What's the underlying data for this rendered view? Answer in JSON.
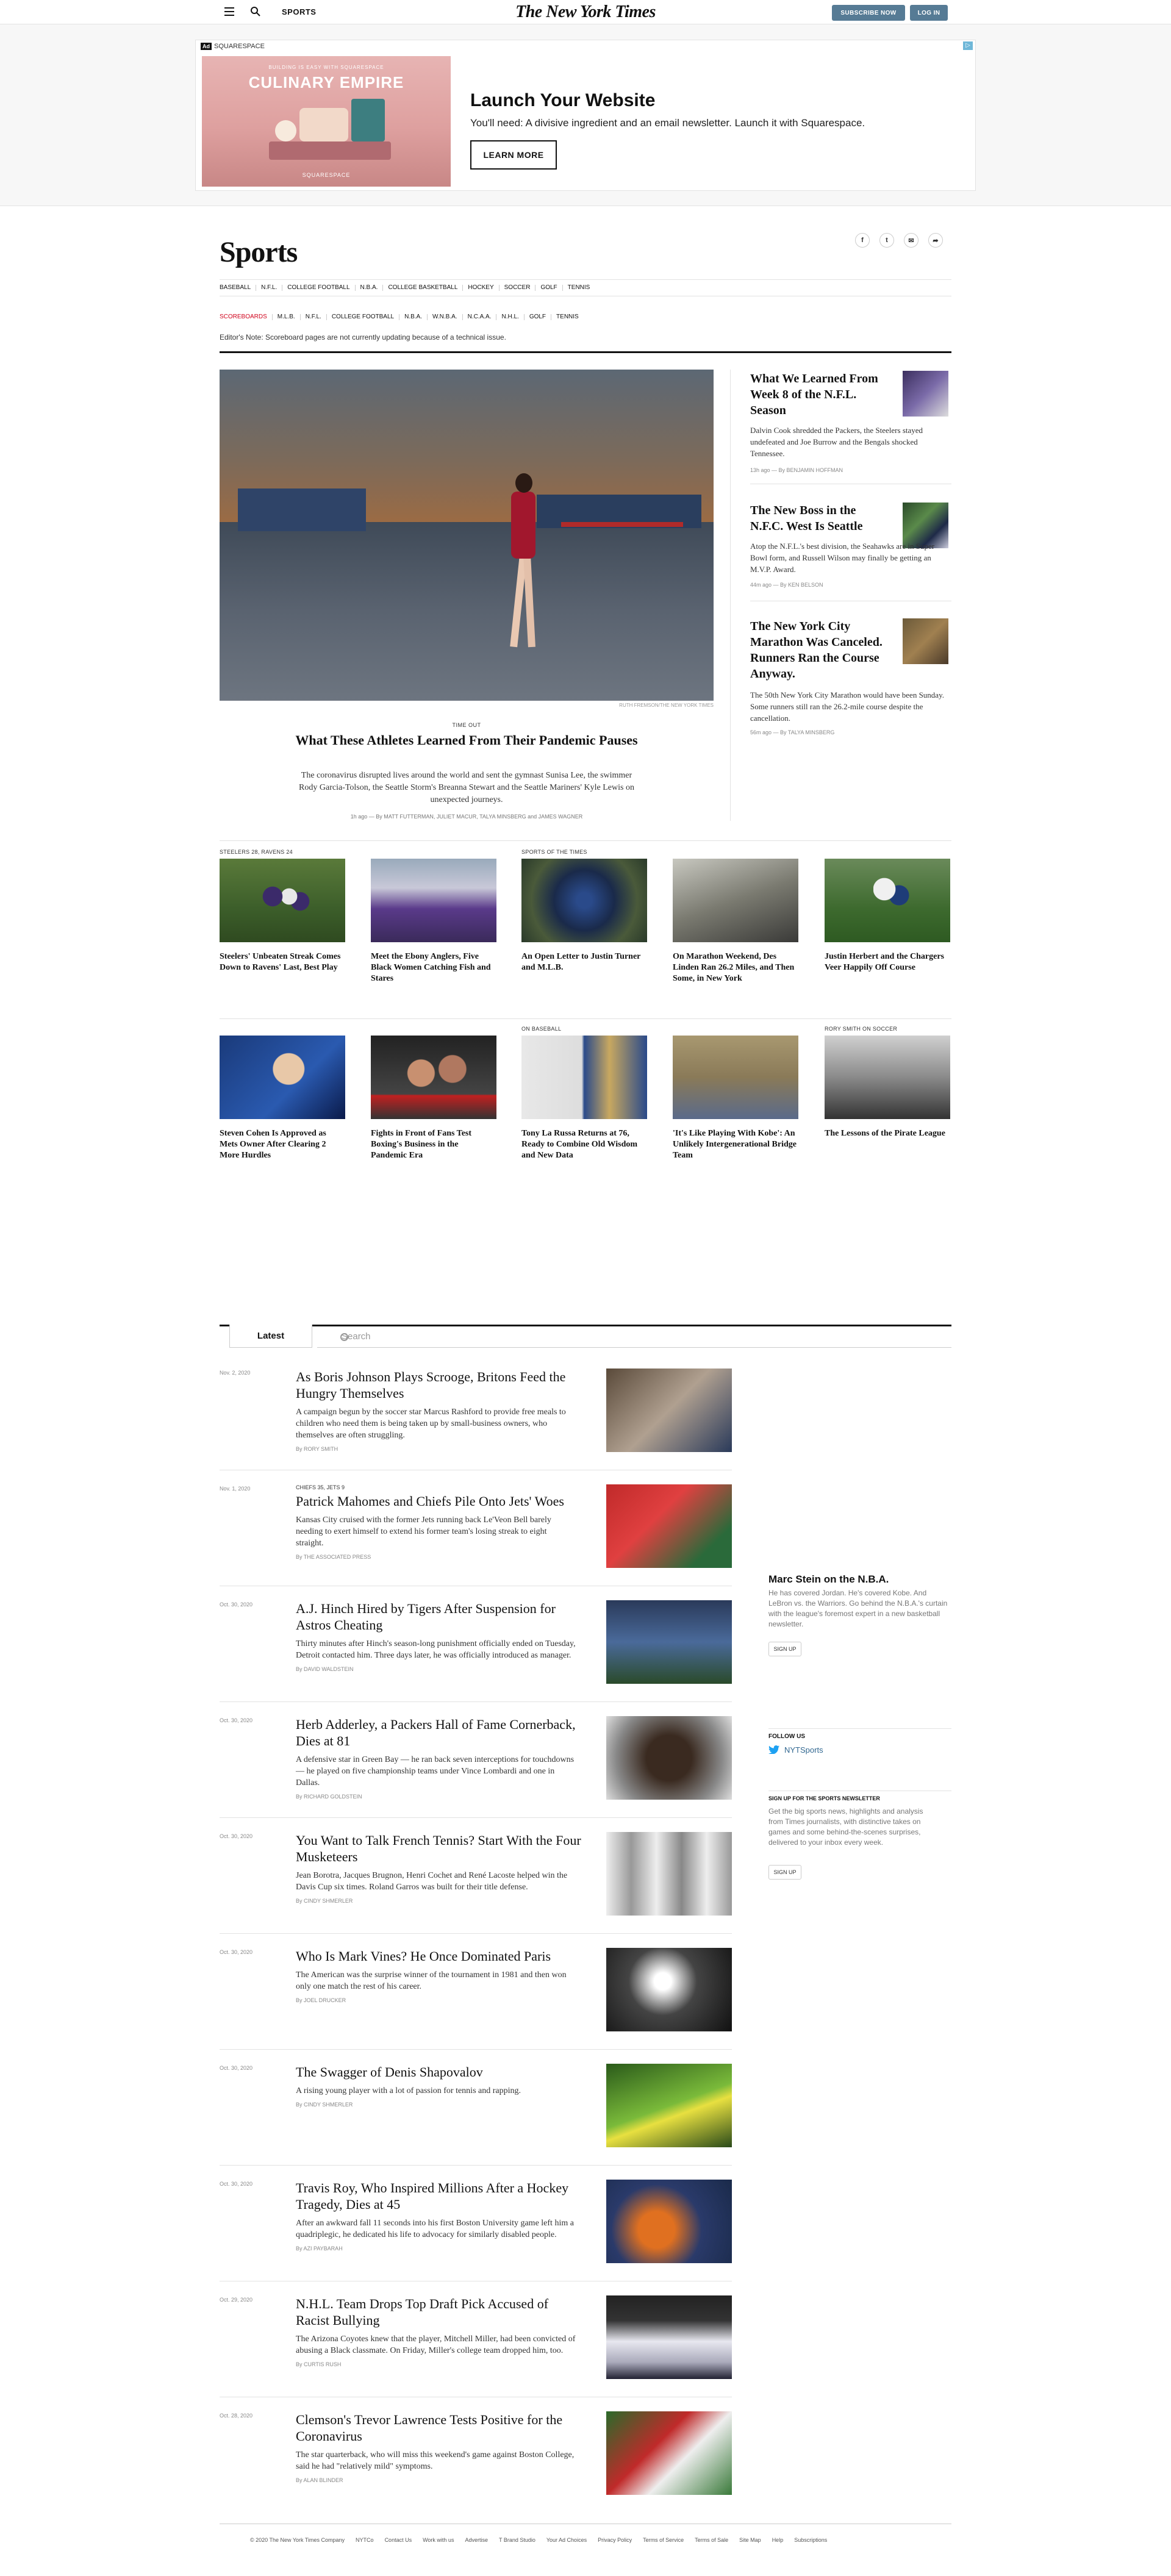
{
  "header": {
    "section": "SPORTS",
    "masthead": "The New York Times",
    "subscribe": "SUBSCRIBE NOW",
    "login": "LOG IN"
  },
  "ad": {
    "label": "SQUARESPACE",
    "badge": "Ad",
    "image_small": "BUILDING IS EASY WITH SQUARESPACE",
    "image_title": "CULINARY EMPIRE",
    "image_brand": "SQUARESPACE",
    "title": "Launch Your Website",
    "text": "You'll need: A divisive ingredient and an email newsletter. Launch it with Squarespace.",
    "button": "LEARN MORE"
  },
  "section": {
    "title": "Sports",
    "social": [
      "f",
      "t",
      "✉",
      "➦"
    ],
    "nav": [
      "BASEBALL",
      "N.F.L.",
      "COLLEGE FOOTBALL",
      "N.B.A.",
      "COLLEGE BASKETBALL",
      "HOCKEY",
      "SOCCER",
      "GOLF",
      "TENNIS"
    ],
    "subnav": [
      "SCOREBOARDS",
      "M.L.B.",
      "N.F.L.",
      "COLLEGE FOOTBALL",
      "N.B.A.",
      "W.N.B.A.",
      "N.C.A.A.",
      "N.H.L.",
      "GOLF",
      "TENNIS"
    ],
    "editor_note": "Editor's Note: Scoreboard pages are not currently updating because of a technical issue."
  },
  "lead": {
    "credit": "RUTH FREMSON/THE NEW YORK TIMES",
    "kicker": "TIME OUT",
    "headline": "What These Athletes Learned From Their Pandemic Pauses",
    "summary": "The coronavirus disrupted lives around the world and sent the gymnast Sunisa Lee, the swimmer Rody Garcia-Tolson, the Seattle Storm's Breanna Stewart and the Seattle Mariners' Kyle Lewis on unexpected journeys.",
    "byline": "1h ago — By MATT FUTTERMAN, JULIET MACUR, TALYA MINSBERG and JAMES WAGNER"
  },
  "right": [
    {
      "headline": "What We Learned From Week 8 of the N.F.L. Season",
      "summary": "Dalvin Cook shredded the Packers, the Steelers stayed undefeated and Joe Burrow and the Bengals shocked Tennessee.",
      "byline": "13h ago — By BENJAMIN HOFFMAN"
    },
    {
      "headline": "The New Boss in the N.F.C. West Is Seattle",
      "summary": "Atop the N.F.L.'s best division, the Seahawks are in Super Bowl form, and Russell Wilson may finally be getting an M.V.P. Award.",
      "byline": "44m ago — By KEN BELSON"
    },
    {
      "headline": "The New York City Marathon Was Canceled. Runners Ran the Course Anyway.",
      "summary": "The 50th New York City Marathon would have been Sunday. Some runners still ran the 26.2-mile course despite the cancellation.",
      "byline": "56m ago — By TALYA MINSBERG"
    }
  ],
  "row1": [
    {
      "kicker": "STEELERS 28, RAVENS 24",
      "headline": "Steelers' Unbeaten Streak Comes Down to Ravens' Last, Best Play"
    },
    {
      "kicker": "",
      "headline": "Meet the Ebony Anglers, Five Black Women Catching Fish and Stares"
    },
    {
      "kicker": "SPORTS OF THE TIMES",
      "headline": "An Open Letter to Justin Turner and M.L.B."
    },
    {
      "kicker": "",
      "headline": "On Marathon Weekend, Des Linden Ran 26.2 Miles, and Then Some, in New York"
    },
    {
      "kicker": "",
      "headline": "Justin Herbert and the Chargers Veer Happily Off Course"
    }
  ],
  "row2": [
    {
      "kicker": "",
      "headline": "Steven Cohen Is Approved as Mets Owner After Clearing 2 More Hurdles"
    },
    {
      "kicker": "",
      "headline": "Fights in Front of Fans Test Boxing's Business in the Pandemic Era"
    },
    {
      "kicker": "ON BASEBALL",
      "headline": "Tony La Russa Returns at 76, Ready to Combine Old Wisdom and New Data"
    },
    {
      "kicker": "",
      "headline": "'It's Like Playing With Kobe': An Unlikely Intergenerational Bridge Team"
    },
    {
      "kicker": "RORY SMITH ON SOCCER",
      "headline": "The Lessons of the Pirate League"
    }
  ],
  "latest": {
    "tab": "Latest",
    "search_placeholder": "Search",
    "items": [
      {
        "date": "Nov. 2, 2020",
        "kicker": "",
        "headline": "As Boris Johnson Plays Scrooge, Britons Feed the Hungry Themselves",
        "summary": "A campaign begun by the soccer star Marcus Rashford to provide free meals to children who need them is being taken up by small-business owners, who themselves are often struggling.",
        "byline": "By RORY SMITH"
      },
      {
        "date": "Nov. 1, 2020",
        "kicker": "CHIEFS 35, JETS 9",
        "headline": "Patrick Mahomes and Chiefs Pile Onto Jets' Woes",
        "summary": "Kansas City cruised with the former Jets running back Le'Veon Bell barely needing to exert himself to extend his former team's losing streak to eight straight.",
        "byline": "By THE ASSOCIATED PRESS"
      },
      {
        "date": "Oct. 30, 2020",
        "kicker": "",
        "headline": "A.J. Hinch Hired by Tigers After Suspension for Astros Cheating",
        "summary": "Thirty minutes after Hinch's season-long punishment officially ended on Tuesday, Detroit contacted him. Three days later, he was officially introduced as manager.",
        "byline": "By DAVID WALDSTEIN"
      },
      {
        "date": "Oct. 30, 2020",
        "kicker": "",
        "headline": "Herb Adderley, a Packers Hall of Fame Cornerback, Dies at 81",
        "summary": "A defensive star in Green Bay — he ran back seven interceptions for touchdowns — he played on five championship teams under Vince Lombardi and one in Dallas.",
        "byline": "By RICHARD GOLDSTEIN"
      },
      {
        "date": "Oct. 30, 2020",
        "kicker": "",
        "headline": "You Want to Talk French Tennis? Start With the Four Musketeers",
        "summary": "Jean Borotra, Jacques Brugnon, Henri Cochet and René Lacoste helped win the Davis Cup six times. Roland Garros was built for their title defense.",
        "byline": "By CINDY SHMERLER"
      },
      {
        "date": "Oct. 30, 2020",
        "kicker": "",
        "headline": "Who Is Mark Vines? He Once Dominated Paris",
        "summary": "The American was the surprise winner of the tournament in 1981 and then won only one match the rest of his career.",
        "byline": "By JOEL DRUCKER"
      },
      {
        "date": "Oct. 30, 2020",
        "kicker": "",
        "headline": "The Swagger of Denis Shapovalov",
        "summary": "A rising young player with a lot of passion for tennis and rapping.",
        "byline": "By CINDY SHMERLER"
      },
      {
        "date": "Oct. 30, 2020",
        "kicker": "",
        "headline": "Travis Roy, Who Inspired Millions After a Hockey Tragedy, Dies at 45",
        "summary": "After an awkward fall 11 seconds into his first Boston University game left him a quadriplegic, he dedicated his life to advocacy for similarly disabled people.",
        "byline": "By AZI PAYBARAH"
      },
      {
        "date": "Oct. 29, 2020",
        "kicker": "",
        "headline": "N.H.L. Team Drops Top Draft Pick Accused of Racist Bullying",
        "summary": "The Arizona Coyotes knew that the player, Mitchell Miller, had been convicted of abusing a Black classmate. On Friday, Miller's college team dropped him, too.",
        "byline": "By CURTIS RUSH"
      },
      {
        "date": "Oct. 28, 2020",
        "kicker": "",
        "headline": "Clemson's Trevor Lawrence Tests Positive for the Coronavirus",
        "summary": "The star quarterback, who will miss this weekend's game against Boston College, said he had \"relatively mild\" symptoms.",
        "byline": "By ALAN BLINDER"
      }
    ]
  },
  "sidebar": {
    "stein_title": "Marc Stein on the N.B.A.",
    "stein_summary": "He has covered Jordan. He's covered Kobe. And LeBron vs. the Warriors. Go behind the N.B.A.'s curtain with the league's foremost expert in a new basketball newsletter.",
    "signup": "SIGN UP",
    "follow": "FOLLOW US",
    "twitter": "NYTSports",
    "nl_title": "SIGN UP FOR THE SPORTS NEWSLETTER",
    "nl_summary": "Get the big sports news, highlights and analysis from Times journalists, with distinctive takes on games and some behind-the-scenes surprises, delivered to your inbox every week."
  },
  "footer": [
    "© 2020 The New York Times Company",
    "NYTCo",
    "Contact Us",
    "Work with us",
    "Advertise",
    "T Brand Studio",
    "Your Ad Choices",
    "Privacy Policy",
    "Terms of Service",
    "Terms of Sale",
    "Site Map",
    "Help",
    "Subscriptions"
  ]
}
